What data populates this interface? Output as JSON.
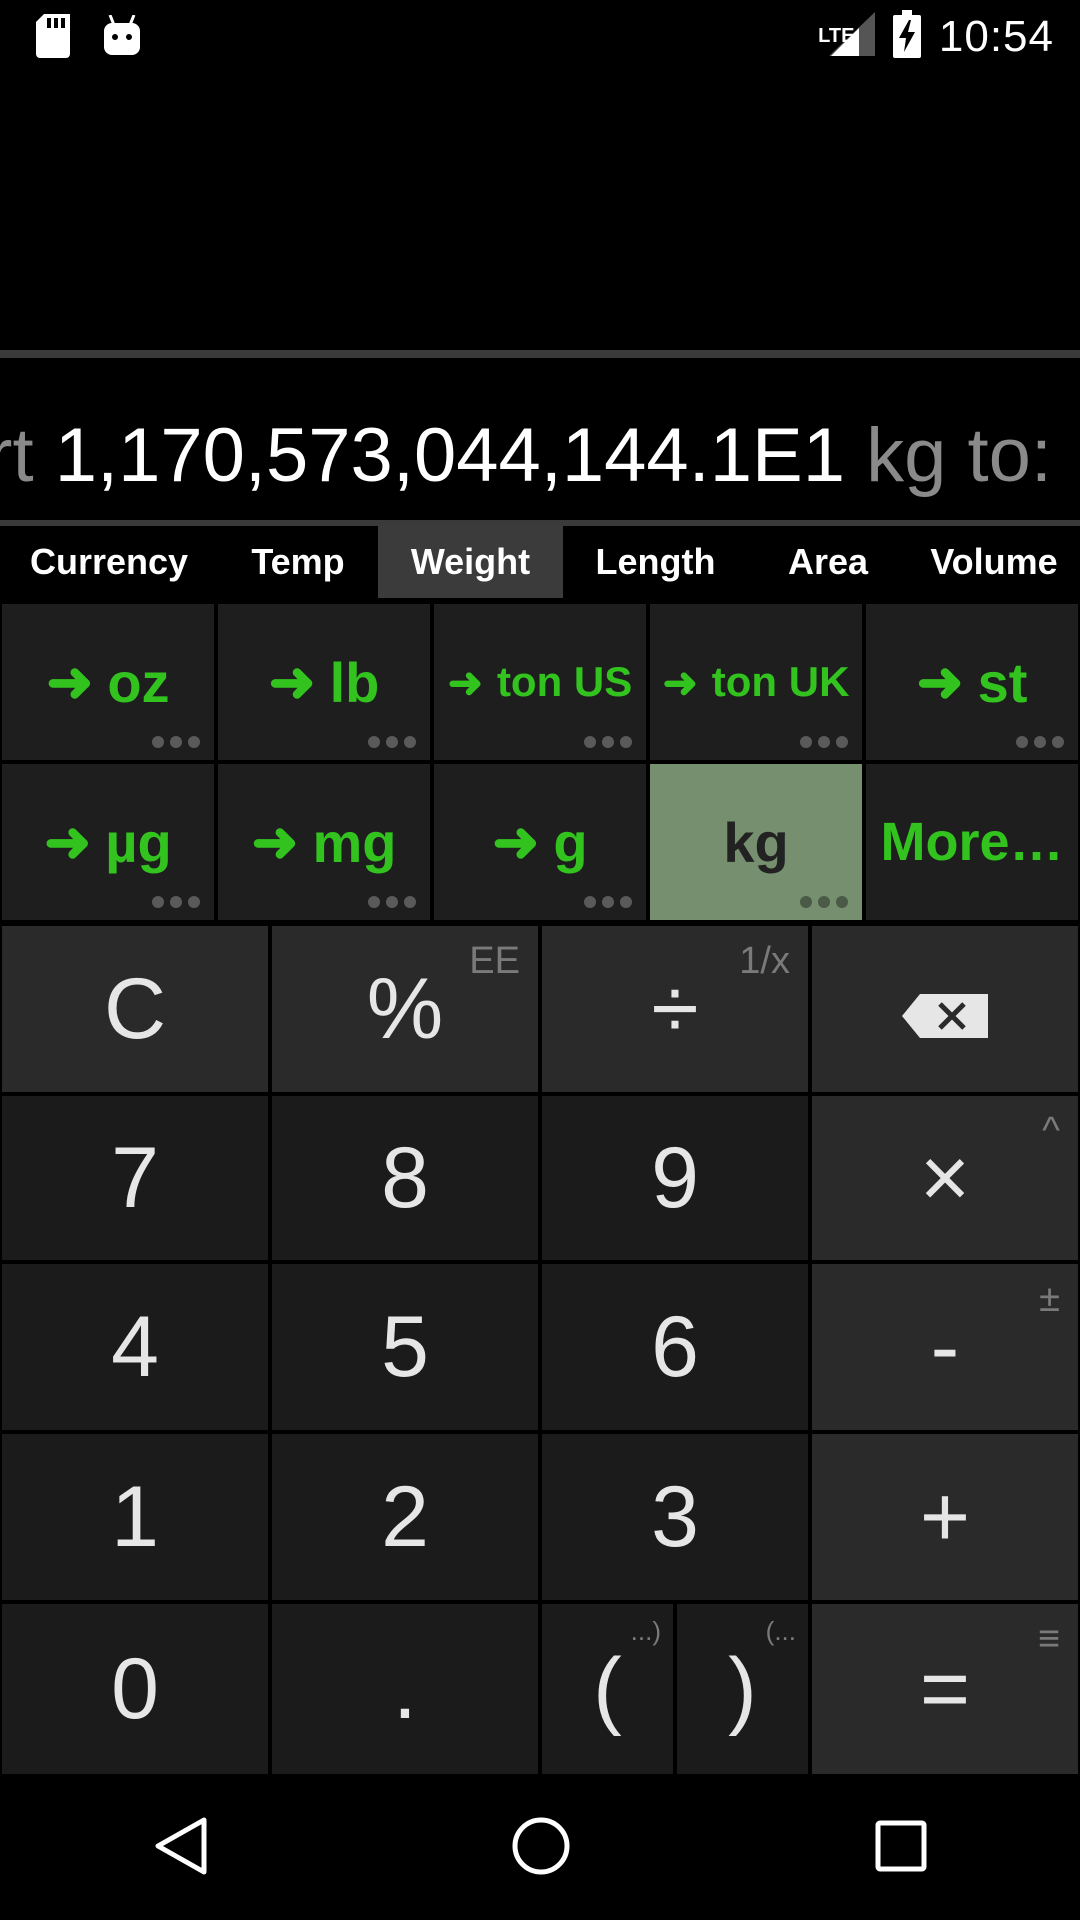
{
  "status_bar": {
    "time": "10:54",
    "network": "LTE"
  },
  "convert": {
    "prefix": "ert ",
    "value": "1,170,573,044,144.1E1",
    "suffix": " kg to:"
  },
  "tabs": [
    "Currency",
    "Temp",
    "Weight",
    "Length",
    "Area",
    "Volume"
  ],
  "active_tab": "Weight",
  "units_row1": [
    "oz",
    "lb",
    "ton US",
    "ton UK",
    "st"
  ],
  "units_row2": [
    "µg",
    "mg",
    "g",
    "kg",
    "More…"
  ],
  "selected_unit": "kg",
  "keys": {
    "clear": "C",
    "percent": "%",
    "percent_alt": "EE",
    "divide": "÷",
    "divide_alt": "1/x",
    "seven": "7",
    "eight": "8",
    "nine": "9",
    "multiply": "×",
    "multiply_alt": "^",
    "four": "4",
    "five": "5",
    "six": "6",
    "minus": "-",
    "minus_alt": "±",
    "one": "1",
    "two": "2",
    "three": "3",
    "plus": "+",
    "zero": "0",
    "dot": ".",
    "open_paren": "(",
    "open_paren_alt": "...)",
    "close_paren": ")",
    "close_paren_alt": "(...",
    "equals": "=",
    "equals_alt": "≡"
  },
  "colors": {
    "accent_green": "#33c31f",
    "selected_unit_bg": "#76906f",
    "key_bg": "#1b1b1b"
  }
}
